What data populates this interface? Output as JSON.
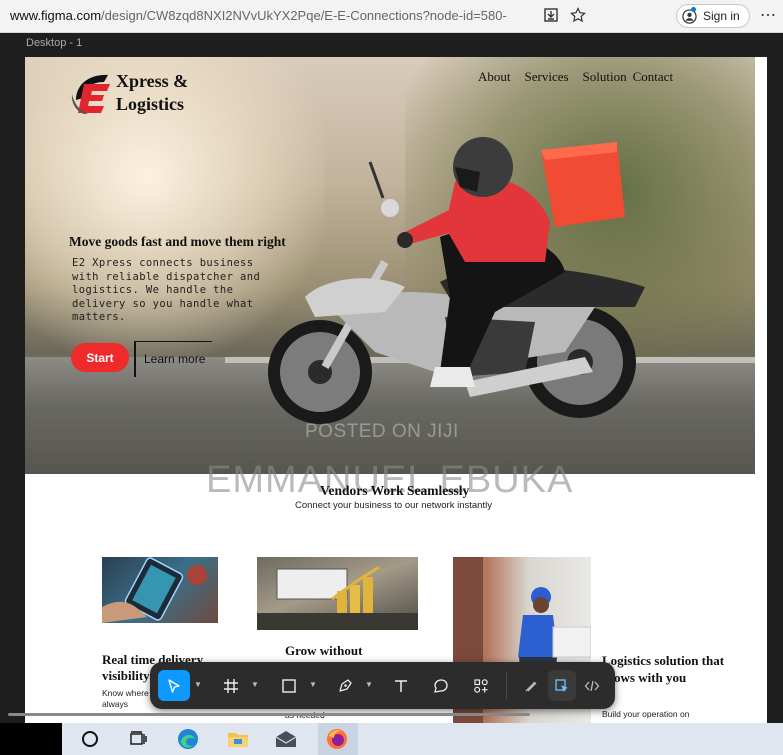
{
  "browser": {
    "url_host": "www.figma.com",
    "url_rest": "/design/CW8zqd8NXI2NVvUkYX2Pqe/E-E-Connections?node-id=580-",
    "sign_in_label": "Sign in"
  },
  "figma": {
    "frame_label": "Desktop - 1"
  },
  "site": {
    "logo_line1": "Xpress &",
    "logo_line2": "Logistics",
    "nav": {
      "about": "About",
      "services": "Services",
      "solution": "Solution",
      "contact": "Contact"
    },
    "hero": {
      "heading": "Move goods fast and move them right",
      "body": "E2 Xpress connects business with reliable dispatcher and logistics. We handle the delivery so you handle what matters.",
      "start_label": "Start",
      "learn_label": "Learn more"
    },
    "watermark_top": "POSTED ON JIJI",
    "watermark_bottom": "EMMANUEL EBUKA",
    "vendors": {
      "title": "Vendors Work Seamlessly",
      "subtitle": "Connect your business to our network instantly"
    },
    "cards": [
      {
        "title": "Real time delivery visibility",
        "body": "Know where your shipment are always"
      },
      {
        "title": "Grow without",
        "body": "as needed"
      },
      {
        "title": "Logistics solution that grows with you",
        "body": "Build your operation on"
      }
    ]
  },
  "toolbar": {
    "tools": [
      "move-tool",
      "frame-tool",
      "shape-tool",
      "pen-tool",
      "text-tool",
      "comment-tool",
      "actions-tool",
      "draw-mode",
      "design-mode",
      "dev-mode"
    ]
  },
  "colors": {
    "accent_red": "#ef2a2a",
    "figma_blue": "#0d99ff",
    "toolbar_bg": "#2c2c2c"
  }
}
